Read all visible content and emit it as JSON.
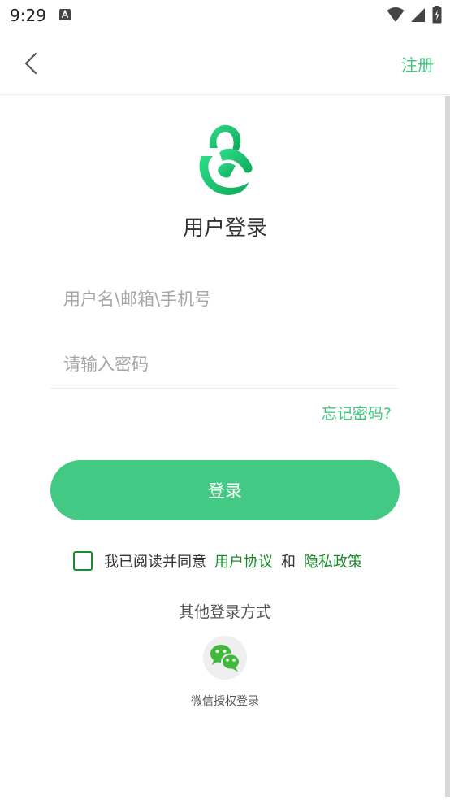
{
  "status_bar": {
    "time": "9:29",
    "icons": [
      "a-notification-icon",
      "wifi-icon",
      "signal-icon",
      "battery-charging-icon"
    ]
  },
  "nav": {
    "back_icon": "chevron-left-icon",
    "register_label": "注册"
  },
  "logo": {
    "icon": "app-logo-icon"
  },
  "title": "用户登录",
  "form": {
    "username_placeholder": "用户名\\邮箱\\手机号",
    "password_placeholder": "请输入密码",
    "forgot_label": "忘记密码?",
    "login_label": "登录"
  },
  "agreement": {
    "prefix": "我已阅读并同意",
    "user_agreement": "用户协议",
    "and": "和",
    "privacy_policy": "隐私政策",
    "checked": false
  },
  "other_login": {
    "title": "其他登录方式",
    "wechat_icon": "wechat-icon",
    "wechat_label": "微信授权登录"
  },
  "colors": {
    "accent": "#42c984",
    "link_green": "#40c880",
    "agreement_green": "#1b8a2c"
  }
}
